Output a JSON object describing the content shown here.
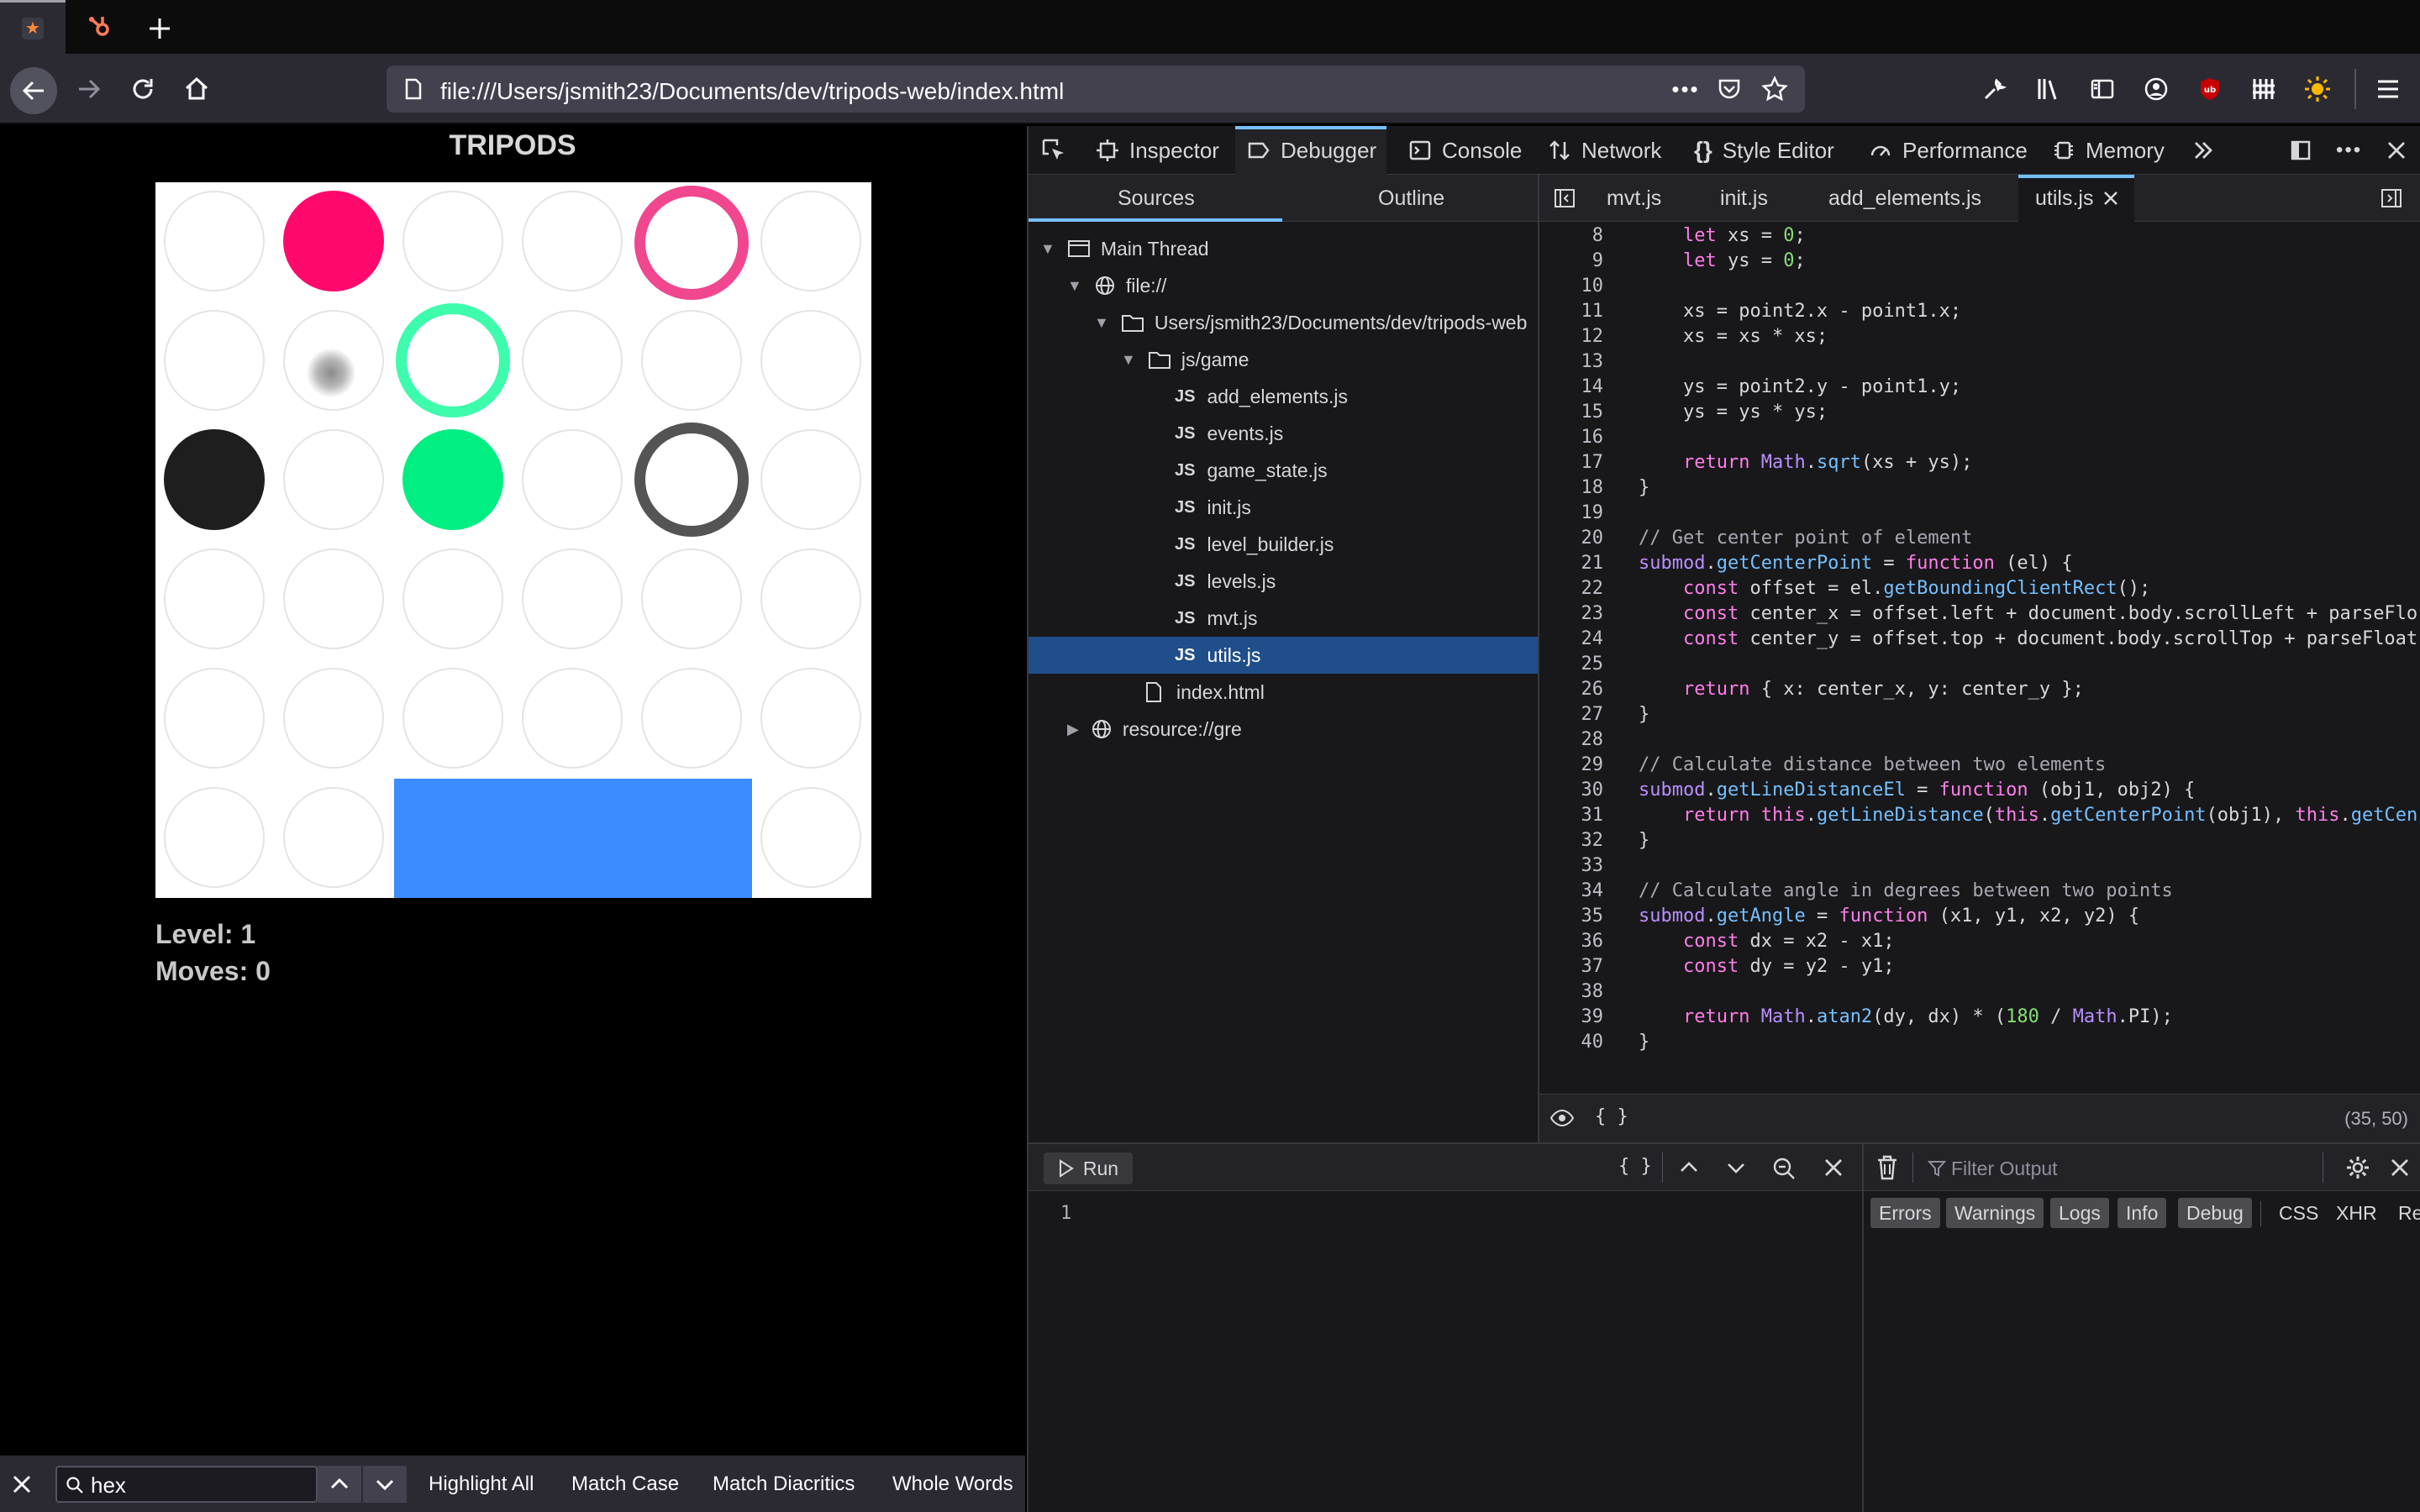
{
  "browser": {
    "url": "file:///Users/jsmith23/Documents/dev/tripods-web/index.html"
  },
  "game": {
    "title": "TRIPODS",
    "level_label": "Level: 1",
    "moves_label": "Moves: 0",
    "colors": {
      "pink": "#ff0a6c",
      "pink_ring": "#f0478f",
      "green_ring": "#3dfcab",
      "green": "#00ee82",
      "black": "#1e1e1e",
      "grey_ring": "#545454",
      "blue_block": "#3c8cff"
    }
  },
  "findbar": {
    "query": "hex",
    "highlight_all": "Highlight All",
    "match_case": "Match Case",
    "match_diacritics": "Match Diacritics",
    "whole_words": "Whole Words"
  },
  "devtools": {
    "tabs": [
      "Inspector",
      "Debugger",
      "Console",
      "Network",
      "Style Editor",
      "Performance",
      "Memory"
    ],
    "sources_tabs": [
      "Sources",
      "Outline"
    ],
    "tree": {
      "main_thread": "Main Thread",
      "file_root": "file://",
      "folder": "Users/jsmith23/Documents/dev/tripods-web",
      "subfolder": "js/game",
      "files": [
        "add_elements.js",
        "events.js",
        "game_state.js",
        "init.js",
        "level_builder.js",
        "levels.js",
        "mvt.js",
        "utils.js"
      ],
      "index": "index.html",
      "resource": "resource://gre"
    },
    "editor_tabs": [
      "mvt.js",
      "init.js",
      "add_elements.js",
      "utils.js"
    ],
    "cursor_position": "(35, 50)",
    "pretty_print": "{ }",
    "console": {
      "run_label": "Run",
      "line_number": "1",
      "filter_placeholder": "Filter Output",
      "filters": [
        "Errors",
        "Warnings",
        "Logs",
        "Info",
        "Debug",
        "CSS",
        "XHR",
        "Re"
      ]
    },
    "code_lines": [
      {
        "n": "8",
        "t": "    let xs = 0;"
      },
      {
        "n": "9",
        "t": "    let ys = 0;"
      },
      {
        "n": "10",
        "t": ""
      },
      {
        "n": "11",
        "t": "    xs = point2.x - point1.x;"
      },
      {
        "n": "12",
        "t": "    xs = xs * xs;"
      },
      {
        "n": "13",
        "t": ""
      },
      {
        "n": "14",
        "t": "    ys = point2.y - point1.y;"
      },
      {
        "n": "15",
        "t": "    ys = ys * ys;"
      },
      {
        "n": "16",
        "t": ""
      },
      {
        "n": "17",
        "t": "    return Math.sqrt(xs + ys);"
      },
      {
        "n": "18",
        "t": "}"
      },
      {
        "n": "19",
        "t": ""
      },
      {
        "n": "20",
        "t": "// Get center point of element"
      },
      {
        "n": "21",
        "t": "submod.getCenterPoint = function (el) {"
      },
      {
        "n": "22",
        "t": "    const offset = el.getBoundingClientRect();"
      },
      {
        "n": "23",
        "t": "    const center_x = offset.left + document.body.scrollLeft + parseFlo"
      },
      {
        "n": "24",
        "t": "    const center_y = offset.top + document.body.scrollTop + parseFloat"
      },
      {
        "n": "25",
        "t": ""
      },
      {
        "n": "26",
        "t": "    return { x: center_x, y: center_y };"
      },
      {
        "n": "27",
        "t": "}"
      },
      {
        "n": "28",
        "t": ""
      },
      {
        "n": "29",
        "t": "// Calculate distance between two elements"
      },
      {
        "n": "30",
        "t": "submod.getLineDistanceEl = function (obj1, obj2) {"
      },
      {
        "n": "31",
        "t": "    return this.getLineDistance(this.getCenterPoint(obj1), this.getCen"
      },
      {
        "n": "32",
        "t": "}"
      },
      {
        "n": "33",
        "t": ""
      },
      {
        "n": "34",
        "t": "// Calculate angle in degrees between two points"
      },
      {
        "n": "35",
        "t": "submod.getAngle = function (x1, y1, x2, y2) {"
      },
      {
        "n": "36",
        "t": "    const dx = x2 - x1;"
      },
      {
        "n": "37",
        "t": "    const dy = y2 - y1;"
      },
      {
        "n": "38",
        "t": ""
      },
      {
        "n": "39",
        "t": "    return Math.atan2(dy, dx) * (180 / Math.PI);"
      },
      {
        "n": "40",
        "t": "}"
      }
    ]
  }
}
